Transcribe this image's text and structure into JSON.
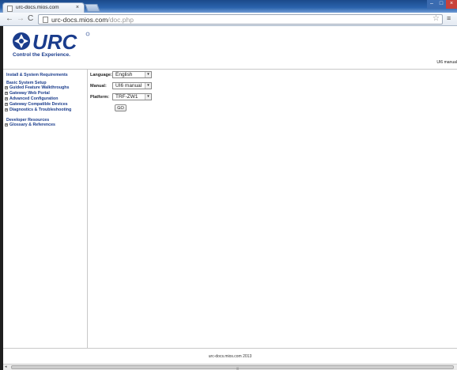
{
  "browser": {
    "tab_title": "urc-docs.mios.com",
    "tab_close": "×",
    "url_host": "urc-docs.mios.com",
    "url_path": "/doc.php",
    "back": "←",
    "forward": "→",
    "reload": "C",
    "star": "☆",
    "menu": "≡",
    "win_min": "–",
    "win_max": "□",
    "win_close": "×"
  },
  "header": {
    "logo_text": "URC",
    "tagline": "Control the Experience.",
    "right_label": "UI6 manual"
  },
  "sidebar": {
    "items": [
      {
        "label": "Install & System Requirements",
        "expandable": false
      },
      {
        "label": "Basic System Setup",
        "expandable": false
      },
      {
        "label": "Guided Feature Walkthroughs",
        "expandable": true
      },
      {
        "label": "Gateway Web Portal",
        "expandable": true
      },
      {
        "label": "Advanced Configuration",
        "expandable": true
      },
      {
        "label": "Gateway Compatible Devices",
        "expandable": true
      },
      {
        "label": "Diagnostics & Troubleshooting",
        "expandable": true
      },
      {
        "label": "Developer Resources",
        "expandable": false
      },
      {
        "label": "Glossary & References",
        "expandable": true
      }
    ],
    "expand_glyph": "+"
  },
  "form": {
    "language_label": "Language:",
    "language_value": "English",
    "manual_label": "Manual:",
    "manual_value": "UI6 manual",
    "platform_label": "Platform:",
    "platform_value": "TRF-ZW1",
    "arrow": "▾",
    "go_label": "GO"
  },
  "footer": {
    "text": "urc-docs.mios.com 2013"
  },
  "colors": {
    "brand": "#1a3c8c",
    "tabstrip": "#2a63ad"
  }
}
